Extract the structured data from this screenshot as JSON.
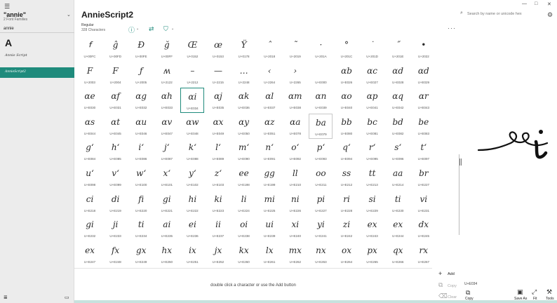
{
  "window": {
    "minimize": "—",
    "maximize": "□",
    "close": "✕"
  },
  "sidebar": {
    "menu_icon": "☰",
    "family_name": "\"annie\"",
    "family_sub": "2 Font Families",
    "chevron": "⌄",
    "search_text": "annie",
    "big_letter": "A",
    "sample_1": "Annie Script",
    "sample_selected": "AnnieScript2",
    "bottom_left_icon": "≣",
    "bottom_right_icon": "▭"
  },
  "header": {
    "title": "AnnieScript2",
    "style": "Regular",
    "count": "328 Characters",
    "info_icon": "ⓘ",
    "swap_icon": "⇄",
    "filter_icon": "⛉",
    "chev": "⌄",
    "more": "···",
    "search_icon": "⌕",
    "search_placeholder": "Search by name or unicode hex",
    "gear": "⚙"
  },
  "grid": {
    "rows": [
      [
        [
          "ꬵ",
          "U+00FC"
        ],
        [
          "ĝ",
          "U+00FD"
        ],
        [
          "Ð",
          "U+00FE"
        ],
        [
          "ğ",
          "U+00FF"
        ],
        [
          "Œ",
          "U+0152"
        ],
        [
          "œ",
          "U+0153"
        ],
        [
          "Ÿ",
          "U+0178"
        ],
        [
          "ˆ",
          "U+2018"
        ],
        [
          "˜",
          "U+2019"
        ],
        [
          "·",
          "U+201A"
        ],
        [
          "°",
          "U+201C"
        ],
        [
          "˙",
          "U+201D"
        ],
        [
          "˝",
          "U+201E"
        ],
        [
          "•",
          "U+2022"
        ]
      ],
      [
        [
          "F",
          "U+2003"
        ],
        [
          "F",
          "U+2004"
        ],
        [
          "ƒ",
          "U+2005"
        ],
        [
          "ʍ",
          "U+2122"
        ],
        [
          "–",
          "U+2212"
        ],
        [
          "—",
          "U+2215"
        ],
        [
          "…",
          "U+2248"
        ],
        [
          "‹",
          "U+2264"
        ],
        [
          "›",
          "U+2265"
        ],
        [
          "",
          "U+E000"
        ],
        [
          "ɑb",
          "U+E026"
        ],
        [
          "ɑc",
          "U+E027"
        ],
        [
          "ɑd",
          "U+E028"
        ],
        [
          "ɑd",
          "U+E029"
        ]
      ],
      [
        [
          "ɑe",
          "U+E030"
        ],
        [
          "ɑf",
          "U+E031"
        ],
        [
          "ɑg",
          "U+E032"
        ],
        [
          "ɑh",
          "U+E033"
        ],
        [
          "ɑi",
          "U+E034"
        ],
        [
          "ɑj",
          "U+E035"
        ],
        [
          "ɑk",
          "U+E036"
        ],
        [
          "ɑl",
          "U+E037"
        ],
        [
          "ɑm",
          "U+E038"
        ],
        [
          "ɑn",
          "U+E039"
        ],
        [
          "ɑo",
          "U+E040"
        ],
        [
          "ɑp",
          "U+E041"
        ],
        [
          "ɑq",
          "U+E042"
        ],
        [
          "ɑr",
          "U+E043"
        ]
      ],
      [
        [
          "ɑs",
          "U+E044"
        ],
        [
          "ɑt",
          "U+E045"
        ],
        [
          "ɑu",
          "U+E046"
        ],
        [
          "ɑv",
          "U+E047"
        ],
        [
          "ɑw",
          "U+E048"
        ],
        [
          "ɑx",
          "U+E049"
        ],
        [
          "ɑy",
          "U+E050"
        ],
        [
          "ɑz",
          "U+E051"
        ],
        [
          "ɑa",
          "U+E078"
        ],
        [
          "ba",
          "U+E079"
        ],
        [
          "bb",
          "U+E080"
        ],
        [
          "bc",
          "U+E081"
        ],
        [
          "bd",
          "U+E082"
        ],
        [
          "be",
          "U+E083"
        ]
      ],
      [
        [
          "gʻ",
          "U+E084"
        ],
        [
          "hʻ",
          "U+E085"
        ],
        [
          "iʻ",
          "U+E086"
        ],
        [
          "jʻ",
          "U+E087"
        ],
        [
          "kʻ",
          "U+E088"
        ],
        [
          "lʻ",
          "U+E089"
        ],
        [
          "mʻ",
          "U+E090"
        ],
        [
          "nʻ",
          "U+E091"
        ],
        [
          "oʻ",
          "U+E092"
        ],
        [
          "pʻ",
          "U+E093"
        ],
        [
          "qʻ",
          "U+E094"
        ],
        [
          "rʻ",
          "U+E095"
        ],
        [
          "sʻ",
          "U+E096"
        ],
        [
          "tʻ",
          "U+E097"
        ]
      ],
      [
        [
          "uʻ",
          "U+E098"
        ],
        [
          "vʻ",
          "U+E099"
        ],
        [
          "wʻ",
          "U+E100"
        ],
        [
          "xʻ",
          "U+E101"
        ],
        [
          "yʻ",
          "U+E102"
        ],
        [
          "zʻ",
          "U+E103"
        ],
        [
          "ee",
          "U+E198"
        ],
        [
          "gg",
          "U+E199"
        ],
        [
          "ll",
          "U+E210"
        ],
        [
          "oo",
          "U+E211"
        ],
        [
          "ss",
          "U+E212"
        ],
        [
          "tt",
          "U+E213"
        ],
        [
          "aa",
          "U+E214"
        ],
        [
          "br",
          "U+E227"
        ]
      ],
      [
        [
          "ci",
          "U+E218"
        ],
        [
          "di",
          "U+E219"
        ],
        [
          "fi",
          "U+E220"
        ],
        [
          "gi",
          "U+E221"
        ],
        [
          "hi",
          "U+E222"
        ],
        [
          "ki",
          "U+E223"
        ],
        [
          "li",
          "U+E224"
        ],
        [
          "mi",
          "U+E225"
        ],
        [
          "ni",
          "U+E226"
        ],
        [
          "pi",
          "U+E227"
        ],
        [
          "ri",
          "U+E228"
        ],
        [
          "si",
          "U+E229"
        ],
        [
          "ti",
          "U+E230"
        ],
        [
          "vi",
          "U+E231"
        ]
      ],
      [
        [
          "gi",
          "U+E232"
        ],
        [
          "ji",
          "U+E233"
        ],
        [
          "ti",
          "U+E234"
        ],
        [
          "ai",
          "U+E235"
        ],
        [
          "ei",
          "U+E236"
        ],
        [
          "ii",
          "U+E237"
        ],
        [
          "oi",
          "U+E238"
        ],
        [
          "ui",
          "U+E239"
        ],
        [
          "xi",
          "U+E240"
        ],
        [
          "yi",
          "U+E241"
        ],
        [
          "zi",
          "U+E242"
        ],
        [
          "ex",
          "U+E243"
        ],
        [
          "ex",
          "U+E244"
        ],
        [
          "dx",
          "U+E245"
        ]
      ],
      [
        [
          "ex",
          "U+E247"
        ],
        [
          "fx",
          "U+E248"
        ],
        [
          "gx",
          "U+E249"
        ],
        [
          "hx",
          "U+E250"
        ],
        [
          "ix",
          "U+E251"
        ],
        [
          "jx",
          "U+E252"
        ],
        [
          "kx",
          "U+E260"
        ],
        [
          "lx",
          "U+E261"
        ],
        [
          "mx",
          "U+E262"
        ],
        [
          "nx",
          "U+E263"
        ],
        [
          "ox",
          "U+E264"
        ],
        [
          "px",
          "U+E265"
        ],
        [
          "qx",
          "U+E266"
        ],
        [
          "rx",
          "U+E267"
        ]
      ]
    ],
    "selected_index": [
      2,
      4
    ],
    "hover_index": [
      3,
      9
    ]
  },
  "preview": {
    "glyph_code": "U+E034"
  },
  "bottom": {
    "hint": "double click a character or use the Add button",
    "add_label": "Add",
    "copy_label": "Copy",
    "clear_label": "Clear",
    "add_icon": "+",
    "copy_icon": "⧉",
    "clear_icon": "⌫",
    "selected_code": "U+E034",
    "foot_copy": "Copy",
    "foot_save": "Save As",
    "foot_fit": "Fit",
    "foot_tools": "Tools",
    "foot_copy_icon": "⧉",
    "foot_save_icon": "▣",
    "foot_fit_icon": "⤢",
    "foot_tools_icon": "⚒"
  }
}
